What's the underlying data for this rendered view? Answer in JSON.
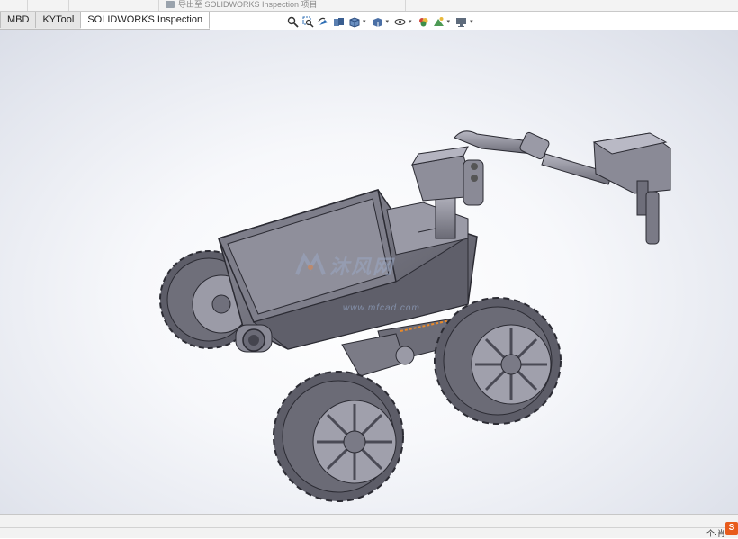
{
  "ribbon": {
    "export_command": "导出至 SOLIDWORKS Inspection 项目"
  },
  "tabs": [
    {
      "label": "MBD"
    },
    {
      "label": "KYTool"
    },
    {
      "label": "SOLIDWORKS Inspection"
    }
  ],
  "hud_toolbar": {
    "icons": [
      "zoom-to-fit-icon",
      "zoom-to-area-icon",
      "previous-view-icon",
      "section-view-icon",
      "view-orientation-icon",
      "display-style-icon",
      "hide-show-items-icon",
      "edit-appearance-icon",
      "apply-scene-icon",
      "view-settings-icon"
    ],
    "colors": {
      "accent": "#2f6fb5",
      "appearance": "#d1463a"
    }
  },
  "viewport": {
    "watermark_text": "沐风网",
    "watermark_url": "www.mfcad.com"
  },
  "statusbar": {
    "right_text": "个·肖"
  }
}
